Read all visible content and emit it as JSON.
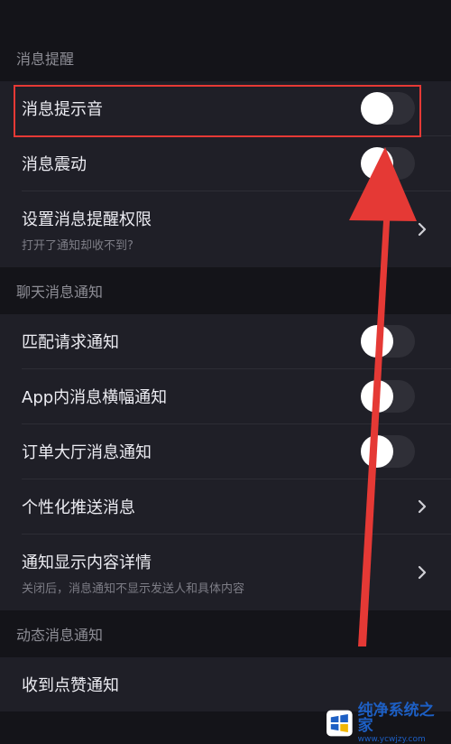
{
  "sections": {
    "message_reminder": {
      "header": "消息提醒",
      "items": [
        {
          "label": "消息提示音",
          "toggle": false
        },
        {
          "label": "消息震动",
          "toggle": false
        },
        {
          "label": "设置消息提醒权限",
          "sublabel": "打开了通知却收不到?"
        }
      ]
    },
    "chat_notifications": {
      "header": "聊天消息通知",
      "items": [
        {
          "label": "匹配请求通知",
          "toggle": false
        },
        {
          "label": "App内消息横幅通知",
          "toggle": false
        },
        {
          "label": "订单大厅消息通知",
          "toggle": false
        },
        {
          "label": "个性化推送消息"
        },
        {
          "label": "通知显示内容详情",
          "sublabel": "关闭后，消息通知不显示发送人和具体内容"
        }
      ]
    },
    "feed_notifications": {
      "header": "动态消息通知",
      "items": [
        {
          "label": "收到点赞通知"
        }
      ]
    }
  },
  "watermark": {
    "title": "纯净系统之家",
    "url": "www.ycwjzy.com"
  },
  "colors": {
    "background": "#141419",
    "row_background": "#1f1f27",
    "toggle_off": "#2f2f37",
    "annotation_red": "#e53935"
  }
}
